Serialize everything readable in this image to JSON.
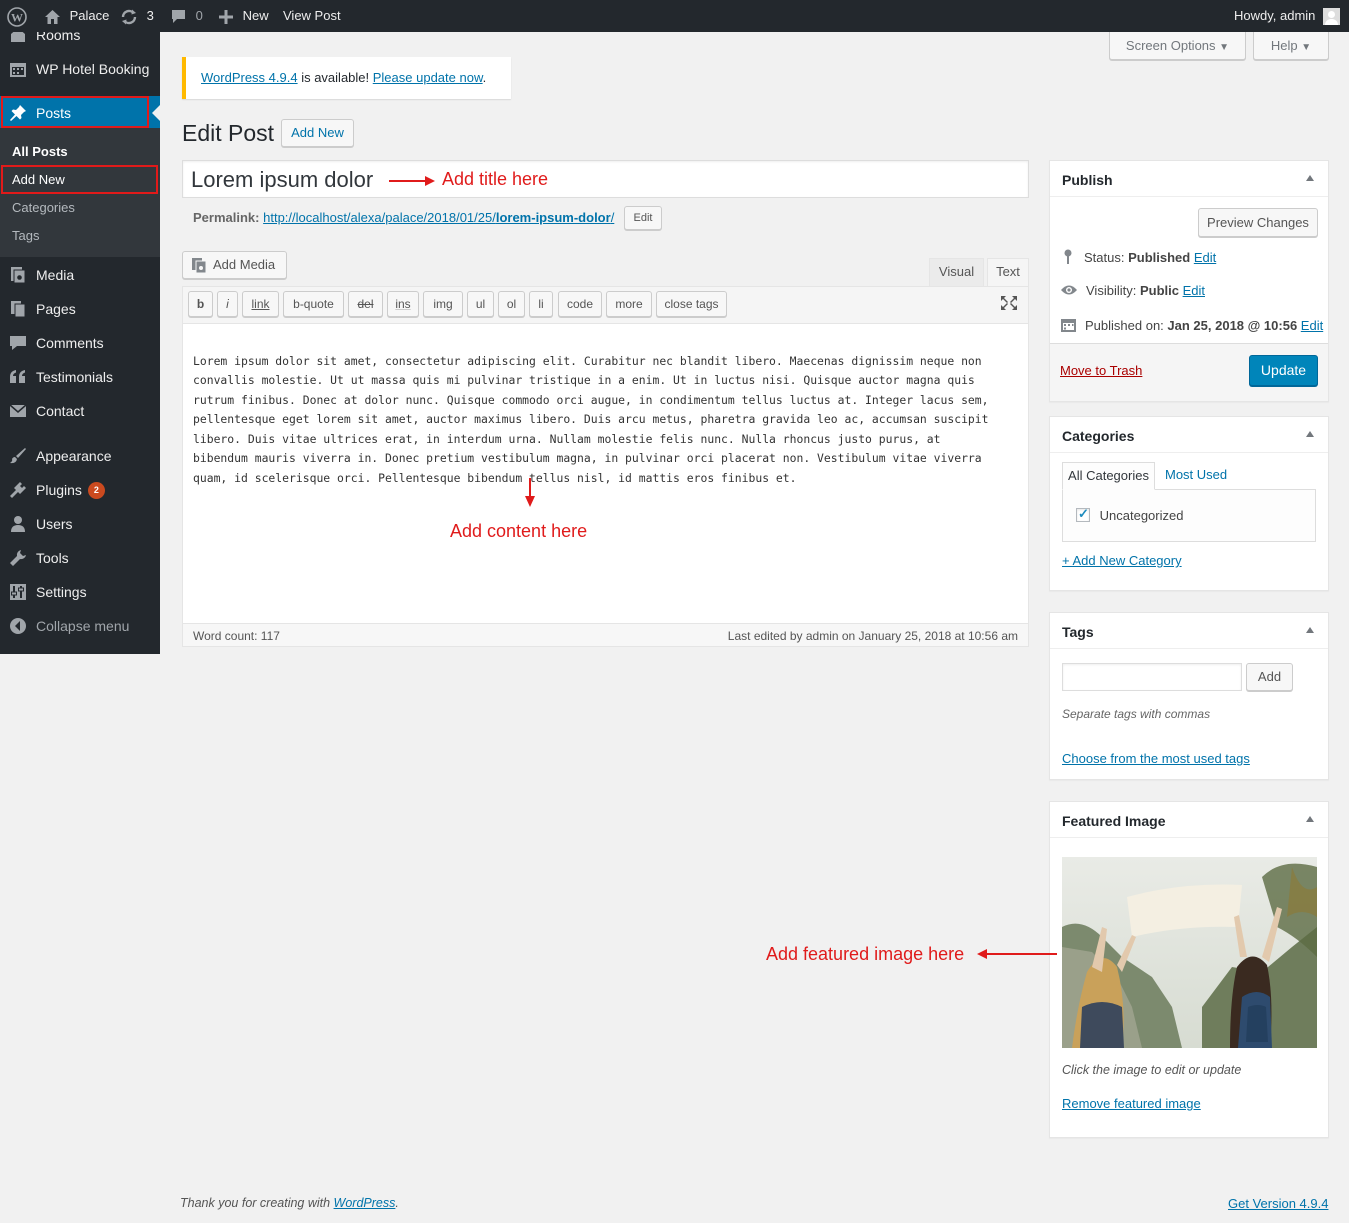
{
  "admin_bar": {
    "site_name": "Palace",
    "updates_count": "3",
    "comments_count": "0",
    "new_label": "New",
    "view_post_label": "View Post",
    "howdy": "Howdy, admin"
  },
  "sidebar": {
    "items": [
      {
        "label": "Rooms",
        "icon": "rooms-icon"
      },
      {
        "label": "WP Hotel Booking",
        "icon": "calendar-icon"
      },
      {
        "label": "Posts",
        "icon": "pin-icon"
      },
      {
        "label": "Media",
        "icon": "media-icon"
      },
      {
        "label": "Pages",
        "icon": "pages-icon"
      },
      {
        "label": "Comments",
        "icon": "comment-icon"
      },
      {
        "label": "Testimonials",
        "icon": "quote-icon"
      },
      {
        "label": "Contact",
        "icon": "mail-icon"
      },
      {
        "label": "Appearance",
        "icon": "brush-icon"
      },
      {
        "label": "Plugins",
        "icon": "plugin-icon",
        "badge": "2"
      },
      {
        "label": "Users",
        "icon": "user-icon"
      },
      {
        "label": "Tools",
        "icon": "wrench-icon"
      },
      {
        "label": "Settings",
        "icon": "settings-icon"
      },
      {
        "label": "Collapse menu",
        "icon": "collapse-icon"
      }
    ],
    "posts_submenu": [
      "All Posts",
      "Add New",
      "Categories",
      "Tags"
    ]
  },
  "screen_meta": {
    "screen_options": "Screen Options",
    "help": "Help"
  },
  "notice": {
    "version_link": "WordPress 4.9.4",
    "middle": " is available! ",
    "update_link": "Please update now",
    "end": "."
  },
  "page": {
    "title": "Edit Post",
    "add_new": "Add New"
  },
  "post": {
    "title": "Lorem ipsum dolor",
    "permalink_label": "Permalink:",
    "permalink_base": "http://localhost/alexa/palace/2018/01/25/",
    "permalink_slug": "lorem-ipsum-dolor",
    "permalink_end": "/",
    "permalink_edit": "Edit"
  },
  "editor": {
    "add_media": "Add Media",
    "tab_visual": "Visual",
    "tab_text": "Text",
    "quicktags": [
      "b",
      "i",
      "link",
      "b-quote",
      "del",
      "ins",
      "img",
      "ul",
      "ol",
      "li",
      "code",
      "more",
      "close tags"
    ],
    "content_lines": [
      "Lorem ipsum dolor sit amet, consectetur adipiscing elit. Curabitur nec blandit libero. Maecenas dignissim neque non",
      "convallis molestie. Ut ut massa quis mi pulvinar tristique in a enim. Ut in luctus nisi. Quisque auctor magna quis",
      "rutrum finibus. Donec at dolor nunc. Quisque commodo orci augue, in condimentum tellus luctus at. Integer lacus sem,",
      "pellentesque eget lorem sit amet, auctor maximus libero. Duis arcu metus, pharetra gravida leo ac, accumsan suscipit",
      "libero. Duis vitae ultrices erat, in interdum urna. Nullam molestie felis nunc. Nulla rhoncus justo purus, at",
      "bibendum mauris viverra in. Donec pretium vestibulum magna, in pulvinar orci placerat non. Vestibulum vitae viverra",
      "quam, id scelerisque orci. Pellentesque bibendum tellus nisl, id mattis eros finibus et."
    ],
    "word_count": "Word count: 117",
    "last_edited": "Last edited by admin on January 25, 2018 at 10:56 am"
  },
  "annotations": {
    "title": "Add title here",
    "content": "Add content here",
    "featured": "Add featured image here"
  },
  "publish": {
    "heading": "Publish",
    "preview": "Preview Changes",
    "status_label": "Status: ",
    "status_value": "Published",
    "visibility_label": "Visibility: ",
    "visibility_value": "Public",
    "published_label": "Published on: ",
    "published_value": "Jan 25, 2018 @ 10:56",
    "edit": "Edit",
    "trash": "Move to Trash",
    "update": "Update"
  },
  "categories": {
    "heading": "Categories",
    "tab_all": "All Categories",
    "tab_most": "Most Used",
    "items": [
      {
        "label": "Uncategorized",
        "checked": true
      }
    ],
    "add_new": "+ Add New Category"
  },
  "tags": {
    "heading": "Tags",
    "input_value": "",
    "add": "Add",
    "hint": "Separate tags with commas",
    "choose": "Choose from the most used tags"
  },
  "featured": {
    "heading": "Featured Image",
    "hint": "Click the image to edit or update",
    "remove": "Remove featured image"
  },
  "footer": {
    "thanks_prefix": "Thank you for creating with ",
    "wp_link": "WordPress",
    "thanks_suffix": ".",
    "version": "Get Version 4.9.4"
  },
  "colors": {
    "admin_bar": "#23282d",
    "accent": "#0073aa",
    "active_menu": "#0073aa",
    "annotation": "#e01b1b",
    "notice_border": "#ffb900"
  }
}
